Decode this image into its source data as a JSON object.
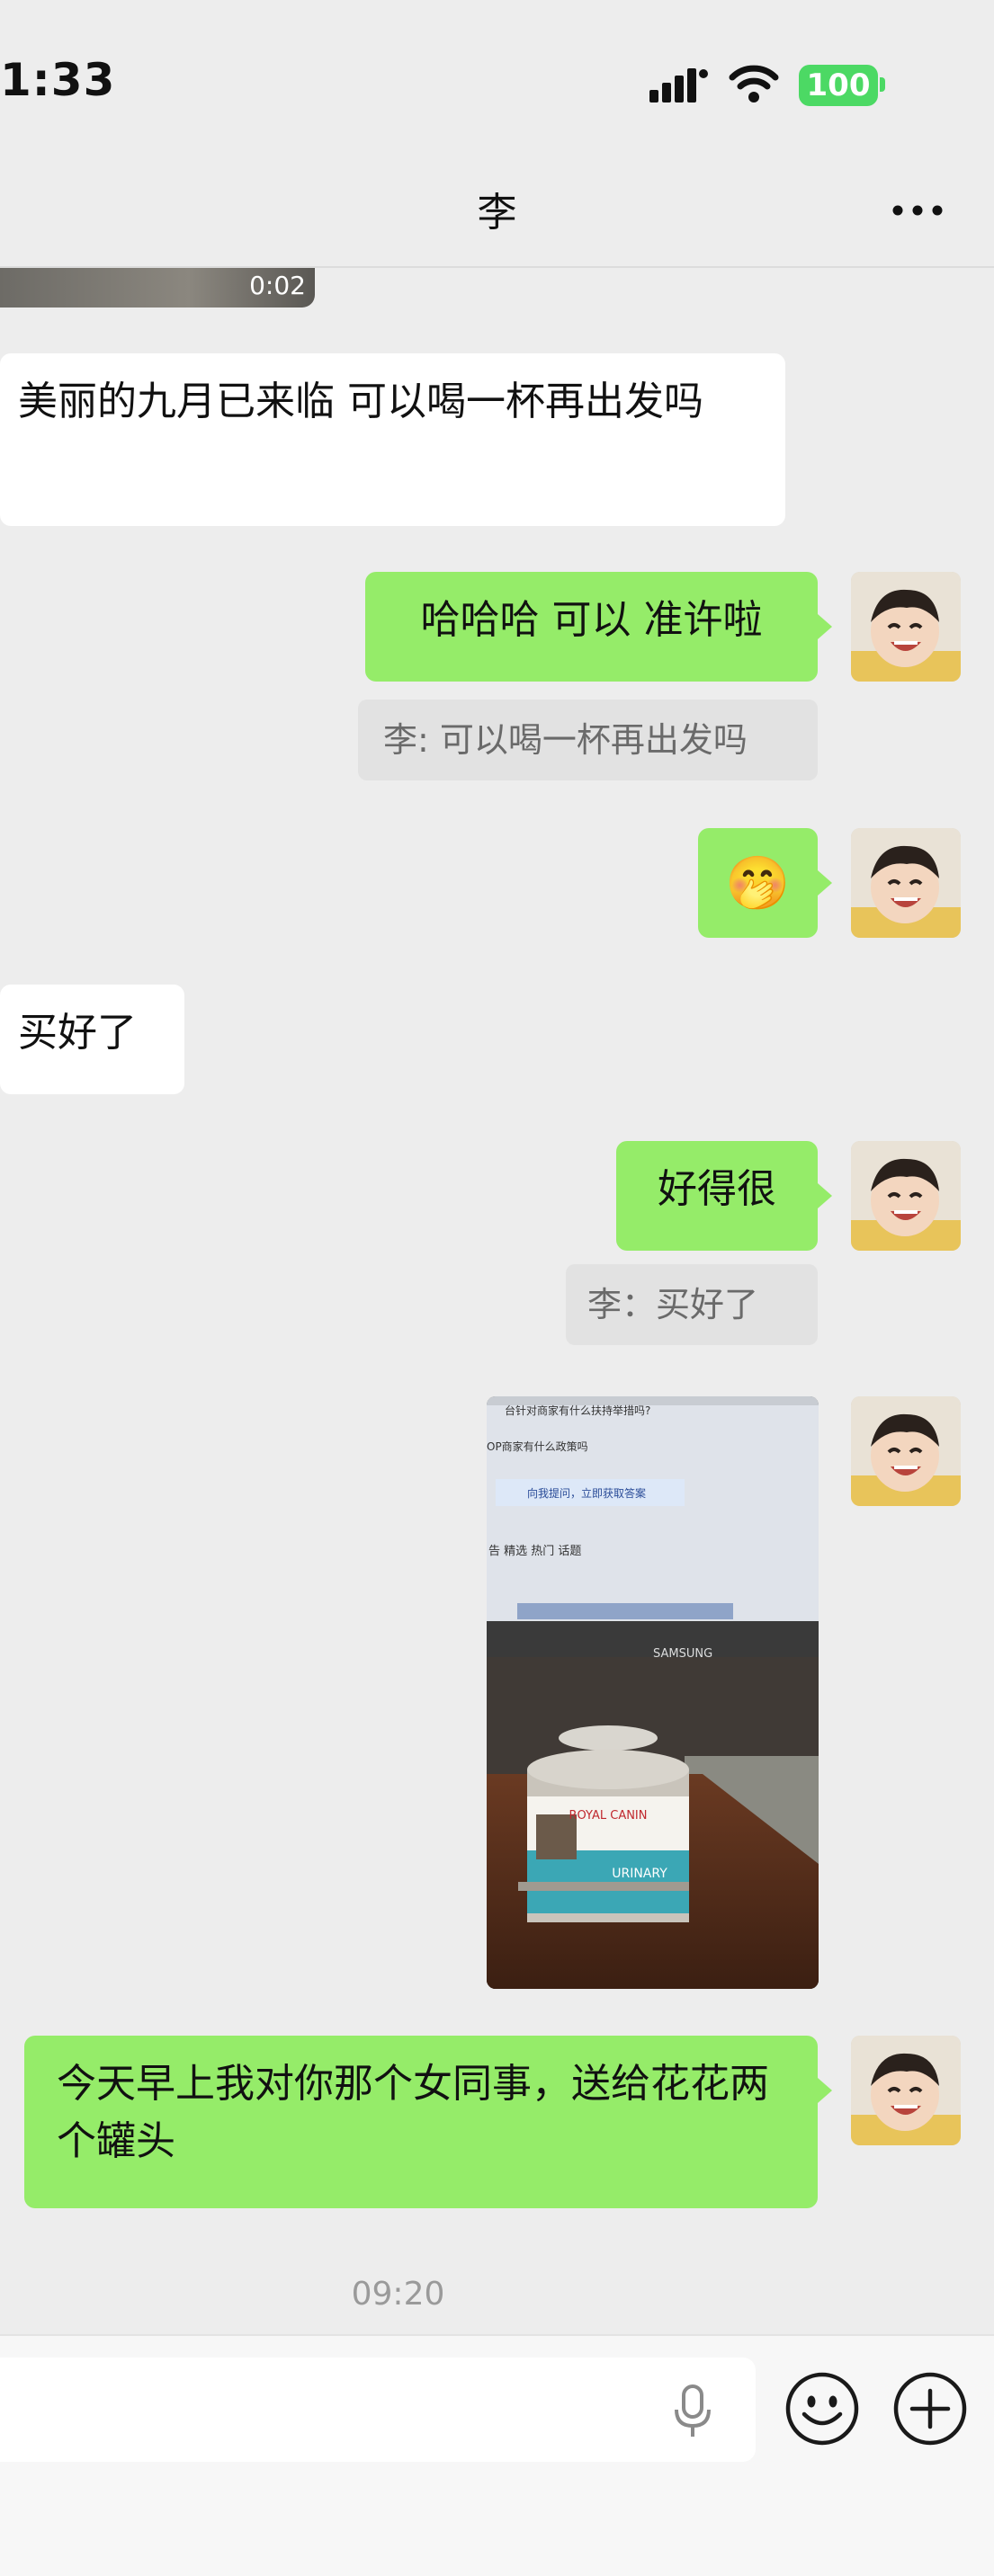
{
  "status_bar": {
    "time": "1:33",
    "battery": "100"
  },
  "nav": {
    "title": "李"
  },
  "video": {
    "duration": "0:02"
  },
  "messages": {
    "m1": "美丽的九月已来临 可以喝一杯再出发吗",
    "m2": "哈哈哈 可以 准许啦",
    "m2_quote": "李: 可以喝一杯再出发吗",
    "m3_emoji": "🤭",
    "m4": "买好了",
    "m5": "好得很",
    "m5_quote": "李：买好了",
    "m7": "今天早上我对你那个女同事，送给花花两个罐头"
  },
  "photo": {
    "screen_texts": [
      "台针对商家有什么扶持举措吗?",
      "OP商家有什么政策吗",
      "向我提问，立即获取答案",
      "告  精选  热门  话题"
    ],
    "monitor_brand": "SAMSUNG",
    "can_brand": "ROYAL CANIN",
    "can_label": "URINARY"
  },
  "timestamp": "09:20",
  "colors": {
    "background": "#ededed",
    "my_bubble": "#95ec69",
    "their_bubble": "#ffffff",
    "battery": "#4cd964"
  }
}
